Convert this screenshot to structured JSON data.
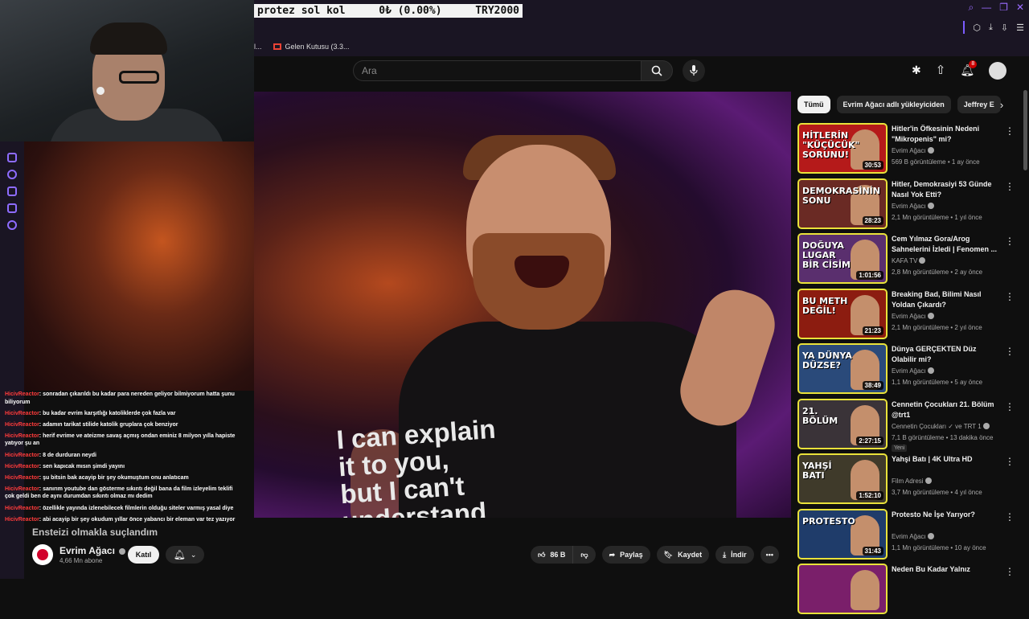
{
  "ticker": {
    "label": "protez sol kol",
    "amount": "0₺ (0.00%)",
    "goal": "TRY2000"
  },
  "bookmarks": {
    "partial": "l...",
    "gmail_label": "Gelen Kutusu (3.3..."
  },
  "header": {
    "search_placeholder": "Ara",
    "notification_count": "8"
  },
  "video": {
    "shirt_text": "I can explain\nit to you,\nbut I can't\nunderstand",
    "overlay_title": "Ensteizi olmakla suçlandım"
  },
  "channel": {
    "name": "Evrim Ağacı",
    "subs": "4,66 Mn abone",
    "join_label": "Katıl"
  },
  "actions": {
    "like_count": "86 B",
    "share": "Paylaş",
    "save": "Kaydet",
    "download": "İndir"
  },
  "chat": [
    {
      "user": "HicivReactor",
      "text": ": sonradan çıkarıldı bu kadar para nereden geliyor bilmiyorum hatta şunu biliyorum"
    },
    {
      "user": "HicivReactor",
      "text": ": bu kadar evrim karşıtlığı katoliklerde çok fazla var"
    },
    {
      "user": "HicivReactor",
      "text": ": adamın tarikat stilide katolik gruplara çok benziyor"
    },
    {
      "user": "HicivReactor",
      "text": ": herif evrime ve ateizme savaş açmış ondan eminiz 8 milyon yılla hapiste yatıyor şu an"
    },
    {
      "user": "HicivReactor",
      "text": ": 8 de durduran neydi"
    },
    {
      "user": "HicivReactor",
      "text": ": sen kapıcak mısın şimdi yayını"
    },
    {
      "user": "HicivReactor",
      "text": ": şu bitsin bak acayip bir şey okumuştum onu anlatıcam"
    },
    {
      "user": "HicivReactor",
      "text": ": sanırım youtube dan gösterme sıkıntı değil bana da film izleyelim teklifi çok geldi ben de aynı durumdan sıkıntı olmaz mı dedim"
    },
    {
      "user": "HicivReactor",
      "text": ": özellikle yayında izlenebilecek filmlerin olduğu siteler varmış yasal diye"
    },
    {
      "user": "HicivReactor",
      "text": ": abi acayip bir şey okudum yıllar önce yabancı bir eleman var tez yazıyor"
    }
  ],
  "chips": [
    "Tümü",
    "Evrim Ağacı adlı yükleyiciden",
    "Jeffrey E"
  ],
  "recommendations": [
    {
      "title": "Hitler'in Öfkesinin Nedeni \"Mikropenis\" mi?",
      "channel": "Evrim Ağacı",
      "meta": "569 B görüntüleme • 1 ay önce",
      "duration": "30:53",
      "thumb_text": "HİTLERİN \"KÜÇÜCÜK\" SORUNU!",
      "thumb_color": "#b51a1a"
    },
    {
      "title": "Hitler, Demokrasiyi 53 Günde Nasıl Yok Etti?",
      "channel": "Evrim Ağacı",
      "meta": "2,1 Mn görüntüleme • 1 yıl önce",
      "duration": "28:23",
      "thumb_text": "DEMOKRASİNİN SONU",
      "thumb_color": "#6a2a24"
    },
    {
      "title": "Cem Yılmaz Gora/Arog Sahnelerini İzledi | Fenomen ...",
      "channel": "KAFA TV",
      "meta": "2,8 Mn görüntüleme • 2 ay önce",
      "duration": "1:01:56",
      "thumb_text": "DOĞUYA LUGAR BİR CİSİM",
      "thumb_color": "#5a2f6e"
    },
    {
      "title": "Breaking Bad, Bilimi Nasıl Yoldan Çıkardı?",
      "channel": "Evrim Ağacı",
      "meta": "2,1 Mn görüntüleme • 2 yıl önce",
      "duration": "21:23",
      "thumb_text": "BU METH DEĞİL!",
      "thumb_color": "#8c1c10"
    },
    {
      "title": "Dünya GERÇEKTEN Düz Olabilir mi?",
      "channel": "Evrim Ağacı",
      "meta": "1,1 Mn görüntüleme • 5 ay önce",
      "duration": "38:49",
      "thumb_text": "YA DÜNYA DÜZSE?",
      "thumb_color": "#2a4a7a"
    },
    {
      "title": "Cennetin Çocukları 21. Bölüm @trt1",
      "channel": "Cennetin Çocukları ✓ ve TRT 1",
      "meta": "7,1 B görüntüleme • 13 dakika önce",
      "duration": "2:27:15",
      "thumb_text": "21. BÖLÜM",
      "thumb_color": "#3a3338",
      "new": "Yeni"
    },
    {
      "title": "Yahşi Batı | 4K Ultra HD",
      "channel": "Film Adresi",
      "meta": "3,7 Mn görüntüleme • 4 yıl önce",
      "duration": "1:52:10",
      "thumb_text": "YAHŞİ BATI",
      "thumb_color": "#3f3a2a"
    },
    {
      "title": "Protesto Ne İşe Yarıyor?",
      "channel": "Evrim Ağacı",
      "meta": "1,1 Mn görüntüleme • 10 ay önce",
      "duration": "31:43",
      "thumb_text": "PROTESTO",
      "thumb_color": "#1f3c6a"
    },
    {
      "title": "Neden Bu Kadar Yalnız",
      "channel": "",
      "meta": "",
      "duration": "",
      "thumb_text": "",
      "thumb_color": "#7a1f6a"
    }
  ]
}
